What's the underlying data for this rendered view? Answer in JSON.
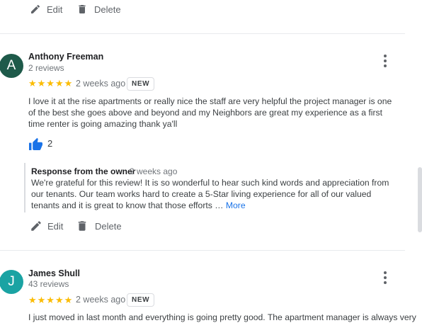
{
  "top_actions": {
    "edit_label": "Edit",
    "delete_label": "Delete"
  },
  "reviews": [
    {
      "avatar_letter": "A",
      "avatar_color": "#1e5a4a",
      "name": "Anthony Freeman",
      "count": "2 reviews",
      "stars": "★★★★★",
      "date": "2 weeks ago",
      "badge": "NEW",
      "text": "I love it at the rise apartments or really nice the staff are very helpful the project manager is one of the best she goes above and beyond and my Neighbors are great my experience as a first time renter is going amazing thank ya'll",
      "likes": "2",
      "owner_title": "Response from the owner",
      "owner_date": "2 weeks ago",
      "owner_text": "We're grateful for this review! It is so wonderful to hear such kind words and appreciation from our tenants. Our team works hard to create a 5-Star living experience for all of our valued tenants and it is great to know that those efforts …",
      "more_label": "More",
      "edit_label": "Edit",
      "delete_label": "Delete"
    },
    {
      "avatar_letter": "J",
      "avatar_color": "#1aa3a3",
      "name": "James Shull",
      "count": "43 reviews",
      "stars": "★★★★★",
      "date": "2 weeks ago",
      "badge": "NEW",
      "text": "I just moved in last month and everything is going pretty good. The apartment manager is always very"
    }
  ],
  "colors": {
    "star": "#fbbc04",
    "like": "#1a73e8",
    "link": "#1a73e8"
  }
}
